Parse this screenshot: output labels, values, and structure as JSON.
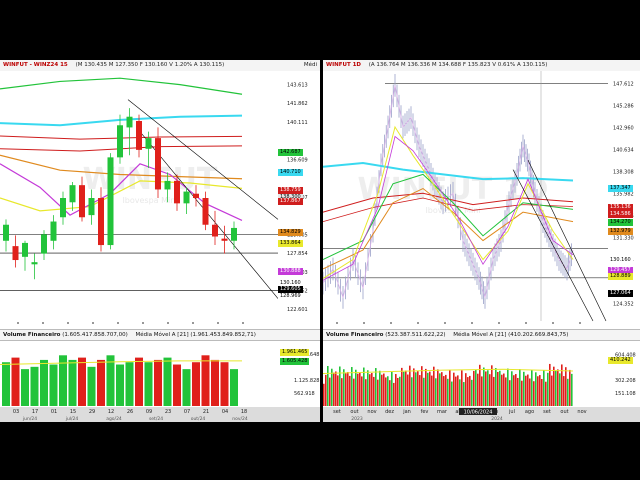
{
  "left": {
    "symbol": "WINFUT - WINZ24 15 ",
    "ohlc": "(M 130.435 M 127.350 F 130.160 V 1.20% A 130.115)",
    "menu": "Médi",
    "watermark": "WINFUT",
    "watermark_sub": "Ibovespa Mini",
    "price_labels": [
      "143.613",
      "141.862",
      "140.111",
      "136.609",
      "133.107",
      "129.605",
      "127.854",
      "126.103",
      "124.352",
      "122.601"
    ],
    "tags": [
      {
        "text": "142.687",
        "bg": "#22c33a",
        "fg": "#000"
      },
      {
        "text": "140.710",
        "bg": "#39d9f0",
        "fg": "#000"
      },
      {
        "text": "138.759",
        "bg": "#cf1d1d",
        "fg": "#fff"
      },
      {
        "text": "138.300",
        "bg": "#e7e7e7",
        "fg": "#000"
      },
      {
        "text": "137.867",
        "bg": "#cf1d1d",
        "fg": "#fff"
      },
      {
        "text": "134.829",
        "bg": "#e08a1e",
        "fg": "#000"
      },
      {
        "text": "133.864",
        "bg": "#e8e82c",
        "fg": "#000"
      },
      {
        "text": "130.888",
        "bg": "#c43ad8",
        "fg": "#fff"
      },
      {
        "text": "130.160",
        "bg": "#ffffff",
        "fg": "#000"
      },
      {
        "text": "129.605",
        "bg": "#000000",
        "fg": "#fff"
      },
      {
        "text": "128.969",
        "bg": "#ffffff",
        "fg": "#000"
      }
    ],
    "volume_title": "Volume Financeiro",
    "volume_value": "(1.605.417.858.707,00)",
    "ma_title": "Média Móvel A [21]",
    "ma_value": "(1.961.453.849.852,71)",
    "vol_labels": [
      "2.251.648",
      "1.125.828",
      "562.918"
    ],
    "vol_tags": [
      {
        "text": "1.961.465",
        "bg": "#e8e82c",
        "fg": "#000"
      },
      {
        "text": "1.605.428",
        "bg": "#22c33a",
        "fg": "#000"
      }
    ],
    "date_labels": [
      "03",
      "17",
      "01",
      "15",
      "29",
      "12",
      "26",
      "09",
      "23",
      "07",
      "21",
      "04",
      "18"
    ],
    "month_labels": [
      "jun/24",
      "jul/24",
      "ago/24",
      "set/24",
      "out/24",
      "nov/24"
    ],
    "candles": [
      {
        "o": 129.0,
        "h": 131.0,
        "l": 128.0,
        "c": 130.5
      },
      {
        "o": 128.5,
        "h": 129.5,
        "l": 126.5,
        "c": 127.2
      },
      {
        "o": 127.5,
        "h": 129.0,
        "l": 126.2,
        "c": 128.8
      },
      {
        "o": 126.8,
        "h": 127.8,
        "l": 125.4,
        "c": 127.0
      },
      {
        "o": 127.8,
        "h": 130.0,
        "l": 127.2,
        "c": 129.6
      },
      {
        "o": 129.0,
        "h": 131.4,
        "l": 128.2,
        "c": 130.8
      },
      {
        "o": 131.2,
        "h": 133.6,
        "l": 130.5,
        "c": 133.0
      },
      {
        "o": 132.6,
        "h": 134.5,
        "l": 131.8,
        "c": 134.2
      },
      {
        "o": 134.2,
        "h": 135.0,
        "l": 130.8,
        "c": 131.2
      },
      {
        "o": 131.4,
        "h": 133.8,
        "l": 130.5,
        "c": 133.0
      },
      {
        "o": 133.0,
        "h": 134.0,
        "l": 128.0,
        "c": 128.6
      },
      {
        "o": 128.6,
        "h": 137.2,
        "l": 128.2,
        "c": 136.8
      },
      {
        "o": 136.8,
        "h": 140.8,
        "l": 136.2,
        "c": 139.8
      },
      {
        "o": 139.6,
        "h": 141.4,
        "l": 137.0,
        "c": 140.6
      },
      {
        "o": 140.2,
        "h": 140.8,
        "l": 136.8,
        "c": 137.5
      },
      {
        "o": 137.6,
        "h": 139.2,
        "l": 135.8,
        "c": 138.6
      },
      {
        "o": 138.6,
        "h": 139.6,
        "l": 133.0,
        "c": 133.8
      },
      {
        "o": 133.8,
        "h": 135.4,
        "l": 132.6,
        "c": 134.6
      },
      {
        "o": 134.6,
        "h": 135.2,
        "l": 131.8,
        "c": 132.5
      },
      {
        "o": 132.5,
        "h": 134.0,
        "l": 131.5,
        "c": 133.6
      },
      {
        "o": 133.4,
        "h": 134.2,
        "l": 132.2,
        "c": 133.0
      },
      {
        "o": 133.0,
        "h": 133.6,
        "l": 130.0,
        "c": 130.5
      },
      {
        "o": 130.5,
        "h": 131.8,
        "l": 128.6,
        "c": 129.4
      },
      {
        "o": 129.2,
        "h": 130.4,
        "l": 127.8,
        "c": 129.0
      },
      {
        "o": 129.0,
        "h": 130.8,
        "l": 128.2,
        "c": 130.2
      }
    ],
    "volumes": [
      1.9,
      2.1,
      1.6,
      1.7,
      2.0,
      1.8,
      2.2,
      2.0,
      2.1,
      1.7,
      2.0,
      2.2,
      1.8,
      1.9,
      2.1,
      1.9,
      2.0,
      2.1,
      1.8,
      1.6,
      1.9,
      2.2,
      2.0,
      1.9,
      1.6
    ]
  },
  "right": {
    "symbol": "WINFUT 1D",
    "ohlc": "(A 136.764 M 136.336 M 134.688 F 135.823 V 0.61% A 130.115)",
    "watermark": "WINFUT 1D",
    "watermark_sub": "Ibovespa Mini",
    "price_labels": [
      "147.612",
      "145.286",
      "142.960",
      "140.634",
      "138.308",
      "135.982",
      "133.656",
      "131.330",
      "129.004",
      "124.352"
    ],
    "tags": [
      {
        "text": "137.347",
        "bg": "#39d9f0",
        "fg": "#000"
      },
      {
        "text": "135.136",
        "bg": "#cf1d1d",
        "fg": "#fff"
      },
      {
        "text": "134.586",
        "bg": "#cf1d1d",
        "fg": "#fff"
      },
      {
        "text": "134.270",
        "bg": "#22c33a",
        "fg": "#000"
      },
      {
        "text": "132.979",
        "bg": "#e08a1e",
        "fg": "#000"
      },
      {
        "text": "130.160",
        "bg": "#ffffff",
        "fg": "#000"
      },
      {
        "text": "129.457",
        "bg": "#c43ad8",
        "fg": "#fff"
      },
      {
        "text": "128.889",
        "bg": "#e8e82c",
        "fg": "#000"
      },
      {
        "text": "127.064",
        "bg": "#000000",
        "fg": "#fff"
      }
    ],
    "volume_title": "Volume Financeiro",
    "volume_value": "(523.387.511.622,22)",
    "ma_title": "Média Móvel A [21]",
    "ma_value": "(410.202.669.843,75)",
    "vol_labels": [
      "604.408",
      "302.208",
      "151.108"
    ],
    "vol_tags": [
      {
        "text": "410.242",
        "bg": "#e8e82c",
        "fg": "#000"
      }
    ],
    "date_labels": [
      "set",
      "out",
      "nov",
      "dez",
      "jan",
      "fev",
      "mar",
      "abr",
      "mai",
      "jun",
      "jul",
      "ago",
      "set",
      "out",
      "nov"
    ],
    "year_labels": [
      "2023",
      "2024"
    ],
    "highlight_date": "10/06/2024"
  }
}
